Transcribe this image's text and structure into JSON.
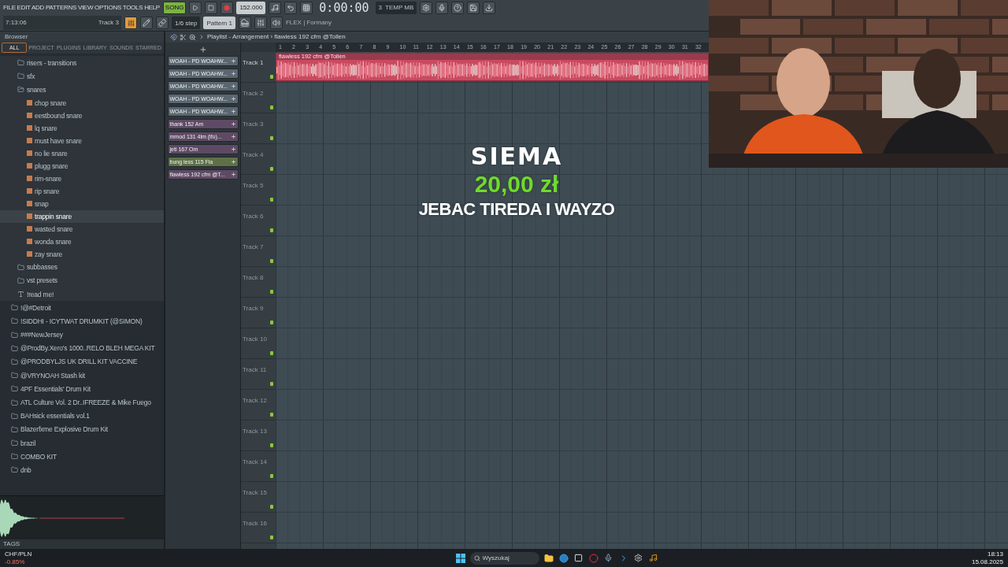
{
  "menu": "FILE EDIT ADD PATTERNS VIEW OPTIONS TOOLS HELP",
  "transport": {
    "mode": "SONG",
    "tempo": "152.000",
    "time": "0:00:00",
    "memory": "3",
    "memory_label": "TEMP MB"
  },
  "hint": {
    "line": "7:13:06",
    "track": "Track 3"
  },
  "snap": "1/6 step",
  "pattern": "Pattern 1",
  "mixer_label": "FLEX | Formany",
  "browser": {
    "title": "Browser",
    "tabs": [
      {
        "label": "ALL",
        "selected": true
      },
      {
        "label": "PROJECT",
        "selected": false
      },
      {
        "label": "PLUGINS",
        "selected": false
      },
      {
        "label": "LIBRARY",
        "selected": false
      },
      {
        "label": "SOUNDS",
        "selected": false
      },
      {
        "label": "STARRED",
        "selected": false
      }
    ],
    "items": [
      {
        "label": "risers - transitions",
        "kind": "folder",
        "selected": false
      },
      {
        "label": "sfx",
        "kind": "folder",
        "selected": false
      },
      {
        "label": "snares",
        "kind": "folder",
        "selected": false,
        "expanded": true,
        "children": [
          {
            "label": "chop snare",
            "kind": "sample",
            "selected": false
          },
          {
            "label": "eestbound snare",
            "kind": "sample",
            "selected": false
          },
          {
            "label": "lq snare",
            "kind": "sample",
            "selected": false
          },
          {
            "label": "must have snare",
            "kind": "sample",
            "selected": false
          },
          {
            "label": "no lie snare",
            "kind": "sample",
            "selected": false
          },
          {
            "label": "plugg snare",
            "kind": "sample",
            "selected": false
          },
          {
            "label": "rim-snare",
            "kind": "sample",
            "selected": false
          },
          {
            "label": "rip snare",
            "kind": "sample",
            "selected": false
          },
          {
            "label": "snap",
            "kind": "sample",
            "selected": false
          },
          {
            "label": "trappin snare",
            "kind": "sample",
            "selected": true
          },
          {
            "label": "wasted snare",
            "kind": "sample",
            "selected": false
          },
          {
            "label": "wonda snare",
            "kind": "sample",
            "selected": false
          },
          {
            "label": "zay snare",
            "kind": "sample",
            "selected": false
          }
        ]
      },
      {
        "label": "subbasses",
        "kind": "folder",
        "selected": false
      },
      {
        "label": "vst presets",
        "kind": "folder",
        "selected": false
      },
      {
        "label": "!read me!",
        "kind": "text",
        "selected": false
      }
    ],
    "folders": [
      {
        "label": "!@#Detroit",
        "kind": "folder",
        "selected": false
      },
      {
        "label": "!SIDDHI - ICYTWAT DRUMKIT (@SIMON)",
        "kind": "folder",
        "selected": false
      },
      {
        "label": "###NewJersey",
        "kind": "folder",
        "selected": false
      },
      {
        "label": "@ProdBy.Xero's 1000..RELO BLEH MEGA KIT",
        "kind": "folder",
        "selected": false
      },
      {
        "label": "@PRODBYLJS UK DRILL KIT VACCINE",
        "kind": "folder",
        "selected": false
      },
      {
        "label": "@VRYNOAH Stash kit",
        "kind": "folder",
        "selected": false
      },
      {
        "label": "4PF Essentials' Drum Kit",
        "kind": "folder",
        "selected": false
      },
      {
        "label": "ATL Culture Vol. 2 Dr..IFREEZE & Mike Fuego",
        "kind": "folder",
        "selected": false
      },
      {
        "label": "BAHsick essentials vol.1",
        "kind": "folder",
        "selected": false
      },
      {
        "label": "Blazerfxme Explosive Drum Kit",
        "kind": "folder",
        "selected": false
      },
      {
        "label": "brazil",
        "kind": "folder",
        "selected": false
      },
      {
        "label": "COMBO KIT",
        "kind": "folder",
        "selected": false
      },
      {
        "label": "dnb",
        "kind": "folder",
        "selected": false
      }
    ],
    "tags_label": "TAGS"
  },
  "channel_rack": [
    {
      "name": "WOAH - PD WOAHW...",
      "color": "#5a6670"
    },
    {
      "name": "WOAH - PD WOAHW...",
      "color": "#5a6670"
    },
    {
      "name": "WOAH - PD WOAHW...",
      "color": "#5a6670"
    },
    {
      "name": "WOAH - PD WOAHW...",
      "color": "#5a6670"
    },
    {
      "name": "WOAH - PD WOAHW...",
      "color": "#5a6670"
    },
    {
      "name": "thank 152 Am",
      "color": "#5e4a64"
    },
    {
      "name": "mmod 131 4lm (lfo)...",
      "color": "#5e4a64"
    },
    {
      "name": "jeti 167 Om",
      "color": "#5e4a64"
    },
    {
      "name": "bung less 115 Fla",
      "color": "#5f7048"
    },
    {
      "name": "flawless 192 cfm @T...",
      "color": "#5e4a64"
    }
  ],
  "playlist": {
    "title": "Playlist - Arrangement › flawless 192 cfm @Tollen",
    "ruler": [
      "1",
      "2",
      "3",
      "4",
      "5",
      "6",
      "7",
      "8",
      "9",
      "10",
      "11",
      "12",
      "13",
      "14",
      "15",
      "16",
      "17",
      "18",
      "19",
      "20",
      "21",
      "22",
      "23",
      "24",
      "25",
      "26",
      "27",
      "28",
      "29",
      "30",
      "31",
      "32"
    ],
    "tracks": [
      "Track 1",
      "Track 2",
      "Track 3",
      "Track 4",
      "Track 5",
      "Track 6",
      "Track 7",
      "Track 8",
      "Track 9",
      "Track 10",
      "Track 11",
      "Track 12",
      "Track 13",
      "Track 14",
      "Track 15",
      "Track 16"
    ],
    "clip": {
      "name": "flawless 192 cfm @Tollen"
    }
  },
  "alert": {
    "title": "SIEMA",
    "amount": "20,00 zł",
    "message": "JEBAC TIREDA I WAYZO"
  },
  "taskbar": {
    "ticker": "CHF/PLN",
    "change": "-0.85%",
    "search_placeholder": "Wyszukaj",
    "time": "18:13",
    "date": "15.08.2025"
  }
}
